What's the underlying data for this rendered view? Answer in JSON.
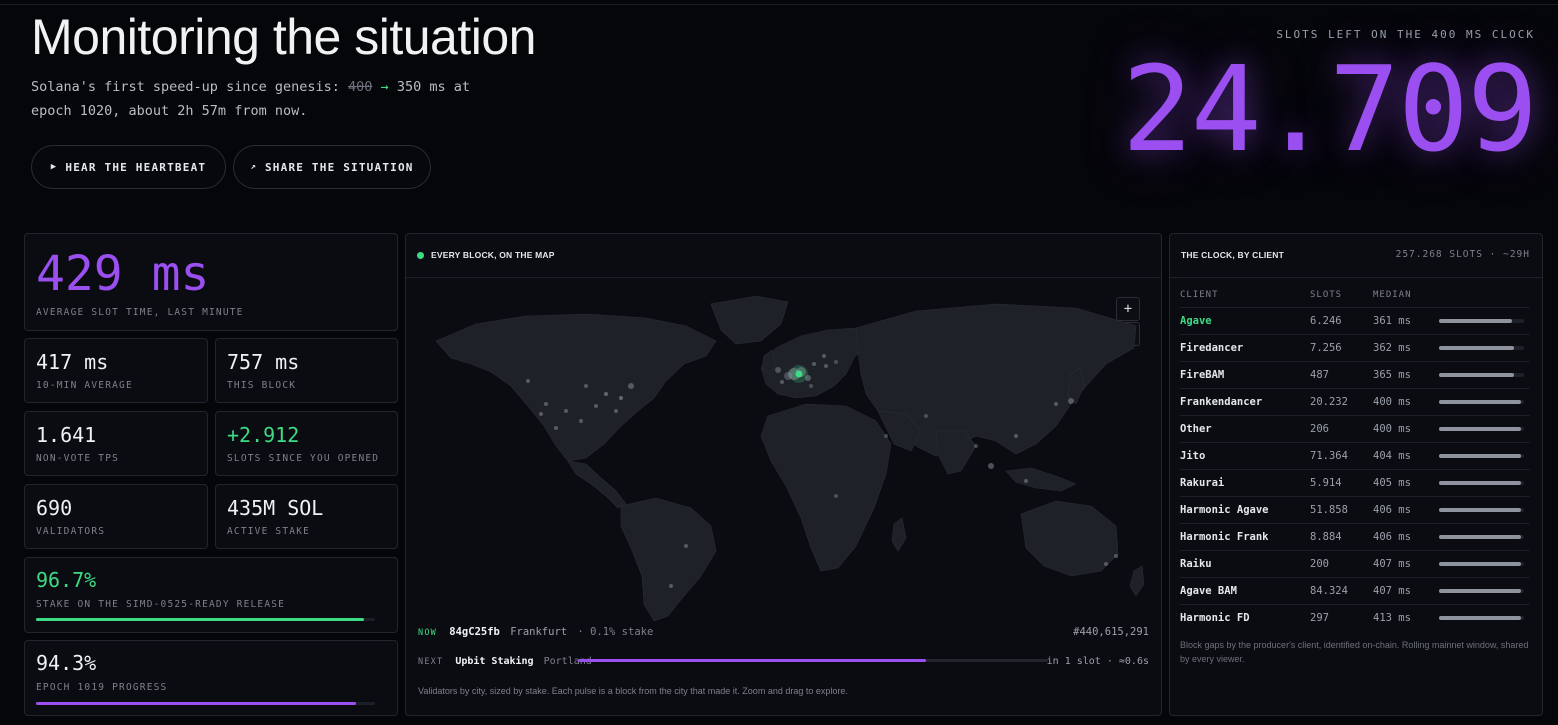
{
  "header": {
    "title": "Monitoring the situation",
    "subtitle_prefix": "Solana's first speed-up since genesis:",
    "old_ms": "400",
    "arrow": "→",
    "subtitle_suffix": "350 ms at epoch 1020, about 2h 57m from now.",
    "buttons": [
      {
        "icon": "▶",
        "label": "HEAR THE HEARTBEAT"
      },
      {
        "icon": "↗",
        "label": "SHARE THE SITUATION"
      }
    ]
  },
  "clock": {
    "label": "SLOTS LEFT ON THE 400 MS CLOCK",
    "value": "24.709"
  },
  "stats": {
    "avg_slot": {
      "value": "429 ms",
      "label": "AVERAGE SLOT TIME, LAST MINUTE"
    },
    "ten_min": {
      "value": "417 ms",
      "label": "10-MIN AVERAGE"
    },
    "this_block": {
      "value": "757 ms",
      "label": "THIS BLOCK"
    },
    "tps": {
      "value": "1.641",
      "label": "NON-VOTE TPS"
    },
    "since_opened": {
      "value": "+2.912",
      "label": "SLOTS SINCE YOU OPENED"
    },
    "validators": {
      "value": "690",
      "label": "VALIDATORS"
    },
    "active_stake": {
      "value": "435M SOL",
      "label": "ACTIVE STAKE"
    },
    "simd_stake": {
      "value": "96.7%",
      "label": "STAKE ON THE SIMD-0525-READY RELEASE",
      "fraction": 0.967,
      "color": "#3ddc84"
    },
    "epoch_progress": {
      "value": "94.3%",
      "label": "EPOCH 1019 PROGRESS",
      "fraction": 0.943,
      "color": "#9b4ff0"
    }
  },
  "map": {
    "title": "EVERY BLOCK, ON THE MAP",
    "zoom_in": "+",
    "zoom_out": "−",
    "now": {
      "tag": "NOW",
      "id": "84gC25fb",
      "city": "Frankfurt",
      "stake": "· 0.1% stake",
      "slot": "#440,615,291"
    },
    "next": {
      "tag": "NEXT",
      "name": "Upbit Staking",
      "city": "Portland",
      "progress": 0.74,
      "eta": "in 1 slot · ≈0.6s"
    },
    "note": "Validators by city, sized by stake. Each pulse is a block from the city that made it. Zoom and drag to explore."
  },
  "clients": {
    "title": "THE CLOCK, BY CLIENT",
    "summary": "257.268 SLOTS · ~29H",
    "columns": [
      "CLIENT",
      "SLOTS",
      "MEDIAN"
    ],
    "rows": [
      {
        "name": "Agave",
        "slots": "6.246",
        "median": "361 ms",
        "bar": 0.86,
        "highlight": true
      },
      {
        "name": "Firedancer",
        "slots": "7.256",
        "median": "362 ms",
        "bar": 0.88
      },
      {
        "name": "FireBAM",
        "slots": "487",
        "median": "365 ms",
        "bar": 0.88
      },
      {
        "name": "Frankendancer",
        "slots": "20.232",
        "median": "400 ms",
        "bar": 0.97
      },
      {
        "name": "Other",
        "slots": "206",
        "median": "400 ms",
        "bar": 0.97
      },
      {
        "name": "Jito",
        "slots": "71.364",
        "median": "404 ms",
        "bar": 0.97
      },
      {
        "name": "Rakurai",
        "slots": "5.914",
        "median": "405 ms",
        "bar": 0.97
      },
      {
        "name": "Harmonic Agave",
        "slots": "51.858",
        "median": "406 ms",
        "bar": 0.97
      },
      {
        "name": "Harmonic Frank",
        "slots": "8.884",
        "median": "406 ms",
        "bar": 0.97
      },
      {
        "name": "Raiku",
        "slots": "200",
        "median": "407 ms",
        "bar": 0.97
      },
      {
        "name": "Agave BAM",
        "slots": "84.324",
        "median": "407 ms",
        "bar": 0.97
      },
      {
        "name": "Harmonic FD",
        "slots": "297",
        "median": "413 ms",
        "bar": 0.97
      }
    ],
    "note": "Block gaps by the producer's client, identified on-chain. Rolling mainnet window, shared by every viewer."
  },
  "colors": {
    "accent": "#9b4ff0",
    "positive": "#3ddc84",
    "background": "#05060a"
  }
}
